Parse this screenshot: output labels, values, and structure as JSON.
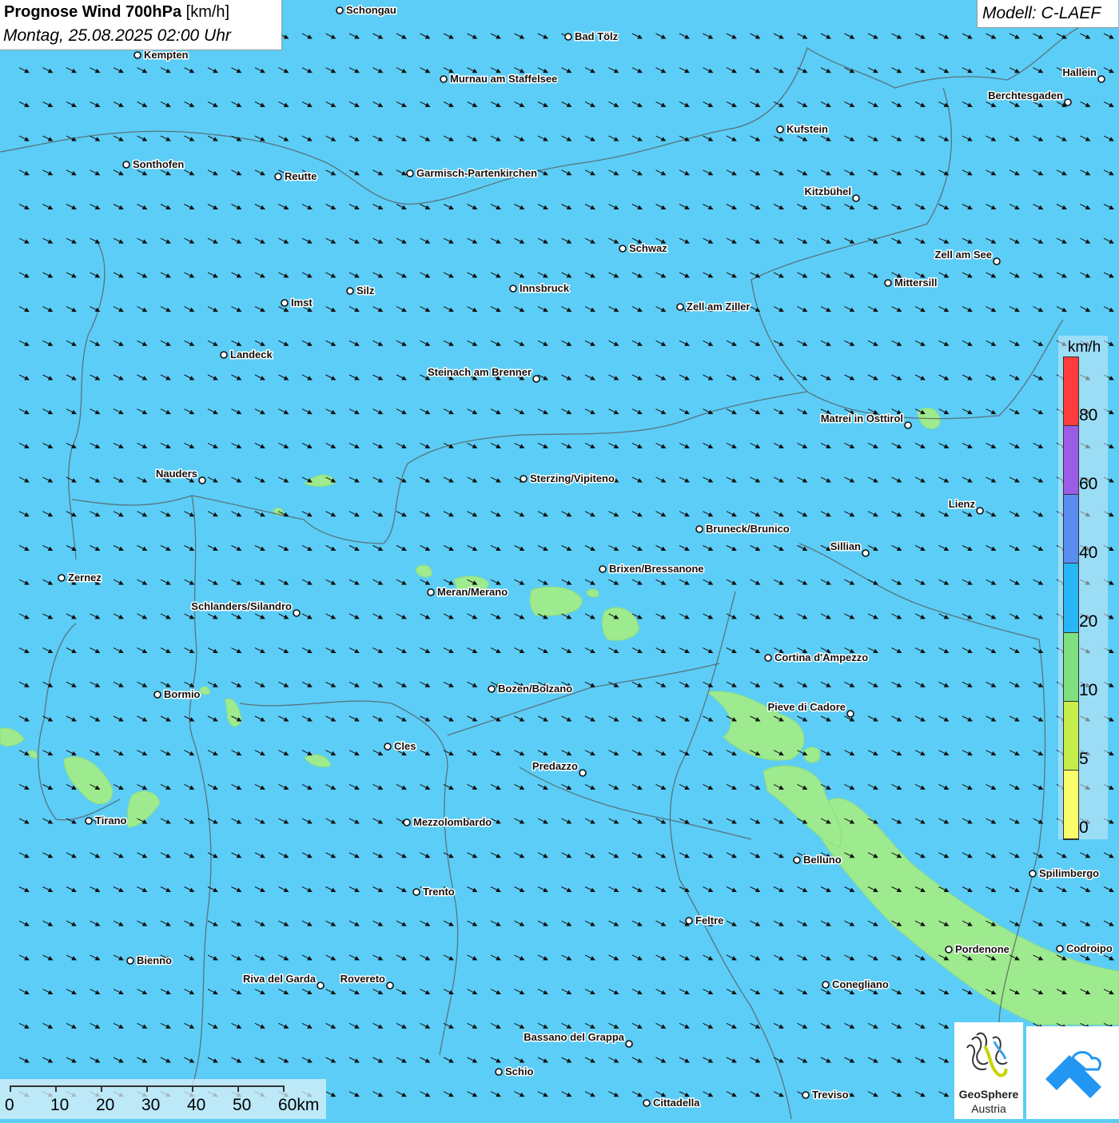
{
  "header": {
    "title_bold": "Prognose Wind 700hPa",
    "title_unit": "[km/h]",
    "datetime": "Montag, 25.08.2025 02:00 Uhr",
    "model": "Modell: C-LAEF"
  },
  "legend": {
    "unit": "km/h",
    "ticks": [
      "80",
      "60",
      "40",
      "20",
      "10",
      "5",
      "0"
    ],
    "colors": [
      "#ff3b3b",
      "#9b5de5",
      "#5b8cf0",
      "#29b6f6",
      "#7ee07e",
      "#c6ee4a",
      "#fbfc6a"
    ]
  },
  "scale": {
    "labels": [
      "0",
      "10",
      "20",
      "30",
      "40",
      "50",
      "60km"
    ]
  },
  "logo": {
    "name": "GeoSphere",
    "country": "Austria"
  },
  "colors": {
    "background_wind": "#5ccdf6",
    "calm_zone": "#9eea8e",
    "border": "#555555",
    "arrow": "#111111"
  },
  "cities": [
    {
      "name": "Schongau"
    },
    {
      "name": "Bad Tölz"
    },
    {
      "name": "Kempten"
    },
    {
      "name": "Murnau am Staffelsee"
    },
    {
      "name": "Hallein"
    },
    {
      "name": "Berchtesgaden"
    },
    {
      "name": "Kufstein"
    },
    {
      "name": "Sonthofen"
    },
    {
      "name": "Reutte"
    },
    {
      "name": "Garmisch-Partenkirchen"
    },
    {
      "name": "Kitzbühel"
    },
    {
      "name": "Schwaz"
    },
    {
      "name": "Zell am See"
    },
    {
      "name": "Mittersill"
    },
    {
      "name": "Silz"
    },
    {
      "name": "Innsbruck"
    },
    {
      "name": "Imst"
    },
    {
      "name": "Zell am Ziller"
    },
    {
      "name": "Landeck"
    },
    {
      "name": "Steinach am Brenner"
    },
    {
      "name": "Matrei in Osttirol"
    },
    {
      "name": "Nauders"
    },
    {
      "name": "Sterzing/Vipiteno"
    },
    {
      "name": "Lienz"
    },
    {
      "name": "Bruneck/Brunico"
    },
    {
      "name": "Sillian"
    },
    {
      "name": "Zernez"
    },
    {
      "name": "Brixen/Bressanone"
    },
    {
      "name": "Meran/Merano"
    },
    {
      "name": "Schlanders/Silandro"
    },
    {
      "name": "Cortina d'Ampezzo"
    },
    {
      "name": "Bozen/Bolzano"
    },
    {
      "name": "Bormio"
    },
    {
      "name": "Pieve di Cadore"
    },
    {
      "name": "Cles"
    },
    {
      "name": "Predazzo"
    },
    {
      "name": "Tirano"
    },
    {
      "name": "Mezzolombardo"
    },
    {
      "name": "Belluno"
    },
    {
      "name": "Spilimbergo"
    },
    {
      "name": "Trento"
    },
    {
      "name": "Feltre"
    },
    {
      "name": "Pordenone"
    },
    {
      "name": "Codroipo"
    },
    {
      "name": "Bienno"
    },
    {
      "name": "Riva del Garda"
    },
    {
      "name": "Rovereto"
    },
    {
      "name": "Conegliano"
    },
    {
      "name": "Bassano del Grappa"
    },
    {
      "name": "Schio"
    },
    {
      "name": "Treviso"
    },
    {
      "name": "Cittadella"
    }
  ]
}
